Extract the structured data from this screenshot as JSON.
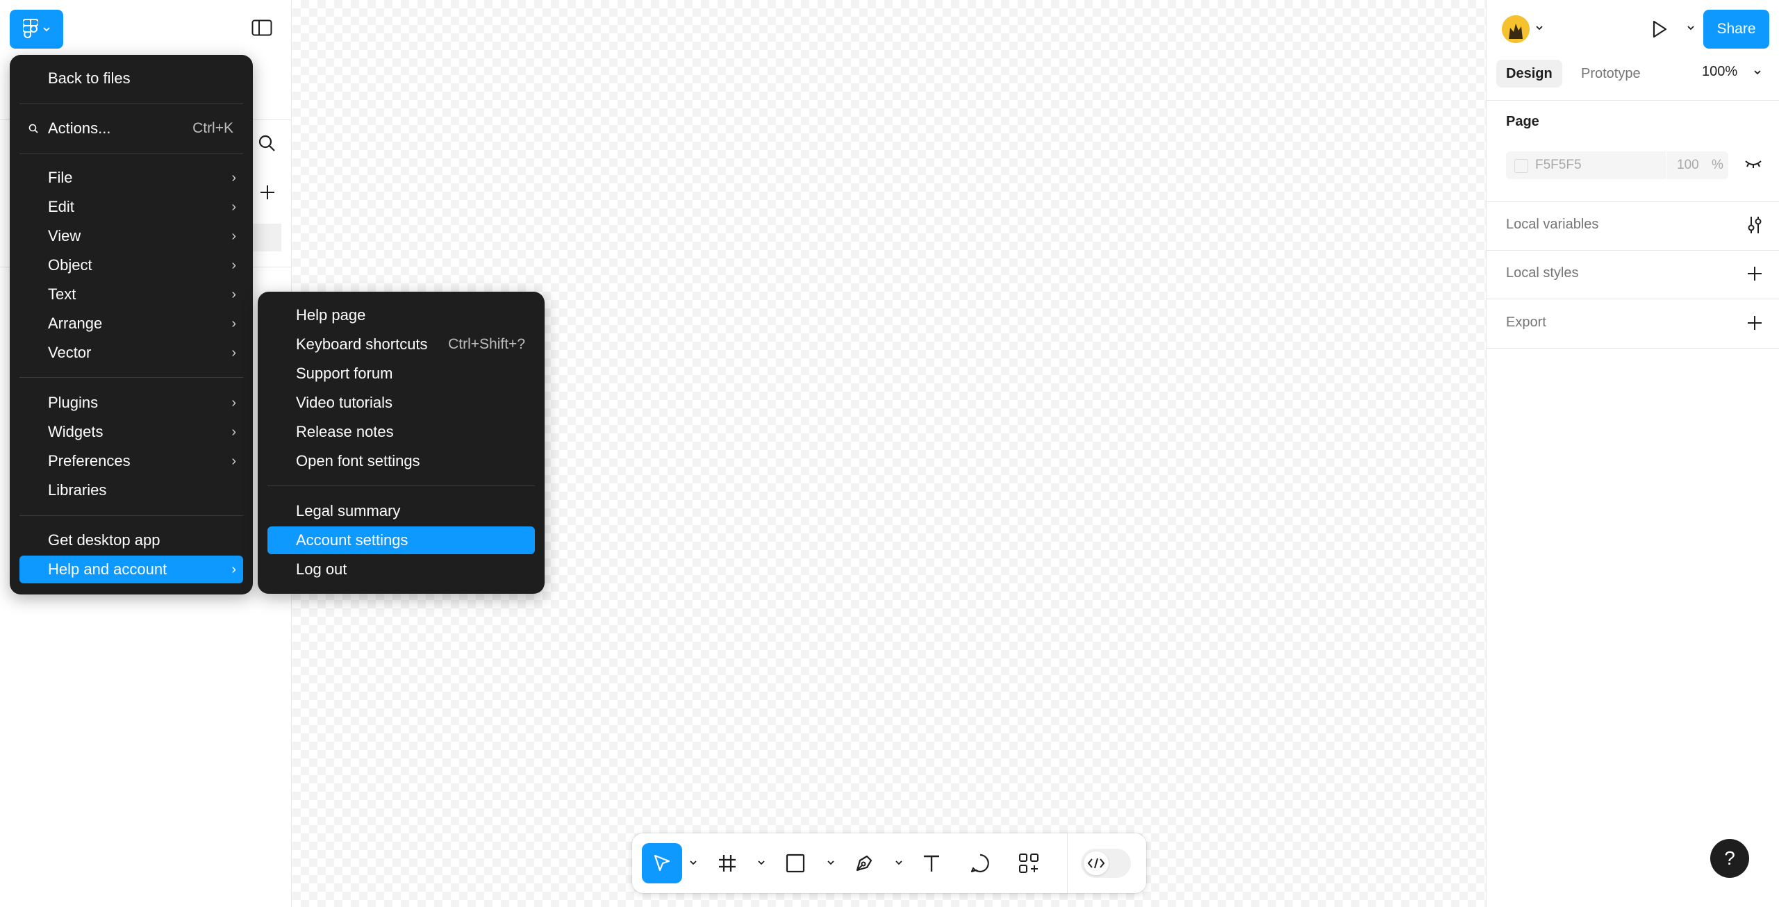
{
  "toolbar_top": {
    "share_label": "Share"
  },
  "tabs": {
    "design": "Design",
    "prototype": "Prototype"
  },
  "zoom": "100%",
  "page_section": {
    "title": "Page",
    "bg_hex": "F5F5F5",
    "opacity": "100",
    "pct": "%"
  },
  "sections": [
    {
      "label": "Local variables",
      "icon": "sliders-icon"
    },
    {
      "label": "Local styles",
      "icon": "plus-icon"
    },
    {
      "label": "Export",
      "icon": "plus-icon"
    }
  ],
  "main_menu": {
    "back": "Back to files",
    "actions": {
      "label": "Actions...",
      "shortcut": "Ctrl+K"
    },
    "group1": [
      "File",
      "Edit",
      "View",
      "Object",
      "Text",
      "Arrange",
      "Vector"
    ],
    "group2": [
      "Plugins",
      "Widgets",
      "Preferences",
      "Libraries"
    ],
    "desktop": "Get desktop app",
    "help": "Help and account"
  },
  "sub_menu": {
    "group1": [
      {
        "label": "Help page",
        "shortcut": ""
      },
      {
        "label": "Keyboard shortcuts",
        "shortcut": "Ctrl+Shift+?"
      },
      {
        "label": "Support forum",
        "shortcut": ""
      },
      {
        "label": "Video tutorials",
        "shortcut": ""
      },
      {
        "label": "Release notes",
        "shortcut": ""
      },
      {
        "label": "Open font settings",
        "shortcut": ""
      }
    ],
    "group2": [
      "Legal summary",
      "Account settings",
      "Log out"
    ],
    "highlighted": "Account settings"
  },
  "help_fab": "?",
  "colors": {
    "accent": "#0d99ff",
    "menu_bg": "#1e1e1e"
  }
}
